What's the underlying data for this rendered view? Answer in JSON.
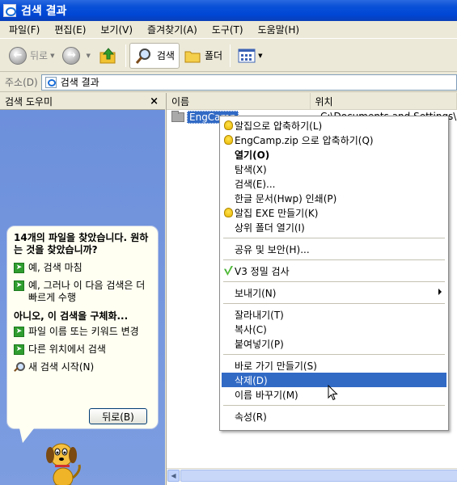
{
  "window": {
    "title": "검색 결과"
  },
  "menubar": [
    "파일(F)",
    "편집(E)",
    "보기(V)",
    "즐겨찾기(A)",
    "도구(T)",
    "도움말(H)"
  ],
  "toolbar": {
    "back": "뒤로",
    "search": "검색",
    "folders": "폴더"
  },
  "address": {
    "label": "주소(D)",
    "value": "검색 결과"
  },
  "left_pane": {
    "title": "검색 도우미",
    "close": "×",
    "question": "14개의 파일을 찾았습니다. 원하는 것을 찾았습니까?",
    "opt1": "예, 검색 마침",
    "opt2": "예, 그러나 이 다음 검색은 더 빠르게 수행",
    "refine_heading": "아니오, 이 검색을 구체화...",
    "opt3": "파일 이름 또는 키워드 변경",
    "opt4": "다른 위치에서 검색",
    "opt5": "새 검색 시작(N)",
    "back_button": "뒤로(B)"
  },
  "results": {
    "col_name": "이름",
    "col_location": "위치",
    "file_name": "EngCamp",
    "file_location": "C:\\Documents and Settings\\"
  },
  "context_menu": {
    "items": [
      {
        "label": "알집으로 압축하기(L)",
        "icon": "alzip-bulb-icon"
      },
      {
        "label": "EngCamp.zip 으로 압축하기(Q)",
        "icon": "alzip-bulb-icon"
      },
      {
        "label": "열기(O)",
        "bold": true
      },
      {
        "label": "탐색(X)"
      },
      {
        "label": "검색(E)..."
      },
      {
        "label": "한글 문서(Hwp) 인쇄(P)"
      },
      {
        "label": "알집 EXE 만들기(K)",
        "icon": "alzip-bulb-icon"
      },
      {
        "label": "상위 폴더 열기(I)"
      },
      {
        "label": "공유 및 보안(H)..."
      },
      {
        "label": "V3 정밀 검사",
        "icon": "v3-icon"
      },
      {
        "label": "보내기(N)",
        "submenu": true
      },
      {
        "label": "잘라내기(T)"
      },
      {
        "label": "복사(C)"
      },
      {
        "label": "붙여넣기(P)"
      },
      {
        "label": "바로 가기 만들기(S)"
      },
      {
        "label": "삭제(D)",
        "highlighted": true
      },
      {
        "label": "이름 바꾸기(M)"
      },
      {
        "label": "속성(R)"
      }
    ]
  },
  "colors": {
    "titlebar": "#0a51d8",
    "highlight": "#316ac5",
    "left_pane_bg": "#6d90dc"
  }
}
